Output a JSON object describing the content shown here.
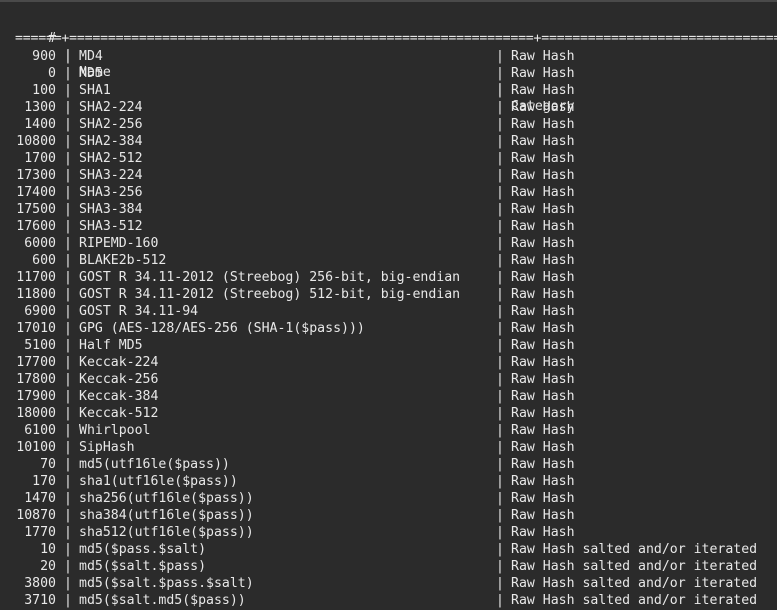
{
  "header": {
    "id": "#",
    "sep": "|",
    "name": "Name",
    "category": "Category"
  },
  "rule": "======+============================================================+=============================================",
  "rows": [
    {
      "id": "900",
      "name": "MD4",
      "category": "Raw Hash"
    },
    {
      "id": "0",
      "name": "MD5",
      "category": "Raw Hash"
    },
    {
      "id": "100",
      "name": "SHA1",
      "category": "Raw Hash"
    },
    {
      "id": "1300",
      "name": "SHA2-224",
      "category": "Raw Hash"
    },
    {
      "id": "1400",
      "name": "SHA2-256",
      "category": "Raw Hash"
    },
    {
      "id": "10800",
      "name": "SHA2-384",
      "category": "Raw Hash"
    },
    {
      "id": "1700",
      "name": "SHA2-512",
      "category": "Raw Hash"
    },
    {
      "id": "17300",
      "name": "SHA3-224",
      "category": "Raw Hash"
    },
    {
      "id": "17400",
      "name": "SHA3-256",
      "category": "Raw Hash"
    },
    {
      "id": "17500",
      "name": "SHA3-384",
      "category": "Raw Hash"
    },
    {
      "id": "17600",
      "name": "SHA3-512",
      "category": "Raw Hash"
    },
    {
      "id": "6000",
      "name": "RIPEMD-160",
      "category": "Raw Hash"
    },
    {
      "id": "600",
      "name": "BLAKE2b-512",
      "category": "Raw Hash"
    },
    {
      "id": "11700",
      "name": "GOST R 34.11-2012 (Streebog) 256-bit, big-endian",
      "category": "Raw Hash"
    },
    {
      "id": "11800",
      "name": "GOST R 34.11-2012 (Streebog) 512-bit, big-endian",
      "category": "Raw Hash"
    },
    {
      "id": "6900",
      "name": "GOST R 34.11-94",
      "category": "Raw Hash"
    },
    {
      "id": "17010",
      "name": "GPG (AES-128/AES-256 (SHA-1($pass)))",
      "category": "Raw Hash"
    },
    {
      "id": "5100",
      "name": "Half MD5",
      "category": "Raw Hash"
    },
    {
      "id": "17700",
      "name": "Keccak-224",
      "category": "Raw Hash"
    },
    {
      "id": "17800",
      "name": "Keccak-256",
      "category": "Raw Hash"
    },
    {
      "id": "17900",
      "name": "Keccak-384",
      "category": "Raw Hash"
    },
    {
      "id": "18000",
      "name": "Keccak-512",
      "category": "Raw Hash"
    },
    {
      "id": "6100",
      "name": "Whirlpool",
      "category": "Raw Hash"
    },
    {
      "id": "10100",
      "name": "SipHash",
      "category": "Raw Hash"
    },
    {
      "id": "70",
      "name": "md5(utf16le($pass))",
      "category": "Raw Hash"
    },
    {
      "id": "170",
      "name": "sha1(utf16le($pass))",
      "category": "Raw Hash"
    },
    {
      "id": "1470",
      "name": "sha256(utf16le($pass))",
      "category": "Raw Hash"
    },
    {
      "id": "10870",
      "name": "sha384(utf16le($pass))",
      "category": "Raw Hash"
    },
    {
      "id": "1770",
      "name": "sha512(utf16le($pass))",
      "category": "Raw Hash"
    },
    {
      "id": "10",
      "name": "md5($pass.$salt)",
      "category": "Raw Hash salted and/or iterated"
    },
    {
      "id": "20",
      "name": "md5($salt.$pass)",
      "category": "Raw Hash salted and/or iterated"
    },
    {
      "id": "3800",
      "name": "md5($salt.$pass.$salt)",
      "category": "Raw Hash salted and/or iterated"
    },
    {
      "id": "3710",
      "name": "md5($salt.md5($pass))",
      "category": "Raw Hash salted and/or iterated"
    }
  ]
}
